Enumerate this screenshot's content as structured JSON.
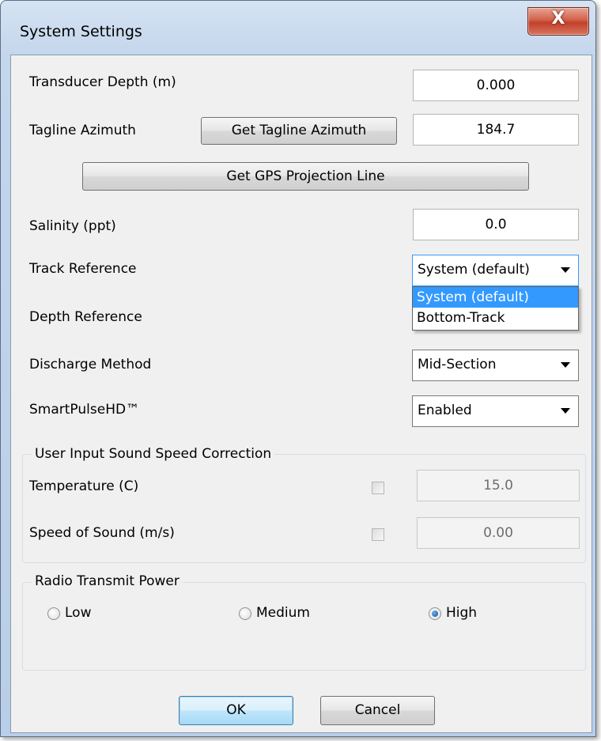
{
  "window": {
    "title": "System Settings",
    "close_glyph": "X"
  },
  "transducer_depth": {
    "label": "Transducer Depth (m)",
    "value": "0.000"
  },
  "tagline_azimuth": {
    "label": "Tagline Azimuth",
    "button": "Get Tagline Azimuth",
    "value": "184.7"
  },
  "gps_projection_button": "Get GPS Projection Line",
  "salinity": {
    "label": "Salinity (ppt)",
    "value": "0.0"
  },
  "track_reference": {
    "label": "Track Reference",
    "selected": "System (default)",
    "options": [
      "System (default)",
      "Bottom-Track"
    ]
  },
  "depth_reference": {
    "label": "Depth Reference"
  },
  "discharge_method": {
    "label": "Discharge Method",
    "selected": "Mid-Section"
  },
  "smartpulse": {
    "label": "SmartPulseHD™",
    "selected": "Enabled"
  },
  "sound_speed_group": {
    "title": "User Input Sound Speed Correction",
    "temperature": {
      "label": "Temperature (C)",
      "value": "15.0",
      "checked": false
    },
    "speed_of_sound": {
      "label": "Speed of Sound (m/s)",
      "value": "0.00",
      "checked": false
    }
  },
  "radio_power": {
    "title": "Radio Transmit Power",
    "options": [
      "Low",
      "Medium",
      "High"
    ],
    "selected": "High"
  },
  "buttons": {
    "ok": "OK",
    "cancel": "Cancel"
  }
}
